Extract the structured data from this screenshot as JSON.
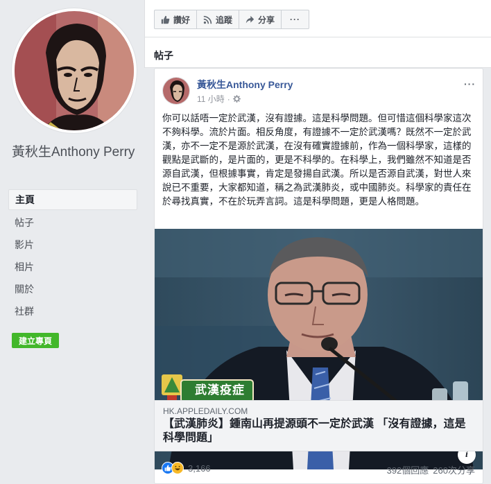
{
  "page": {
    "name": "黃秋生Anthony Perry"
  },
  "nav": {
    "items": [
      {
        "label": "主頁",
        "active": true
      },
      {
        "label": "帖子",
        "active": false
      },
      {
        "label": "影片",
        "active": false
      },
      {
        "label": "相片",
        "active": false
      },
      {
        "label": "關於",
        "active": false
      },
      {
        "label": "社群",
        "active": false
      }
    ],
    "create_page": "建立專頁"
  },
  "actions": {
    "like": "讚好",
    "follow": "追蹤",
    "share": "分享",
    "more": "···"
  },
  "section": {
    "title": "帖子"
  },
  "post": {
    "author": "黃秋生Anthony Perry",
    "time": "11 小時",
    "separator": "·",
    "more": "···",
    "text": "你可以話唔一定於武漢，沒有證據。這是科學問題。但可惜這個科學家這次不夠科學。流於片面。相反角度，有證據不一定於武漢嗎？既然不一定於武漢，亦不一定不是源於武漢，在沒有確實證據前，作為一個科學家，這樣的觀點是武斷的，是片面的，更是不科學的。在科學上，我們雖然不知道是否源自武漢，但根據事實，肯定是發揚自武漢。所以是否源自武漢，對世人來說已不重要，大家都知道，稱之為武漢肺炎，或中國肺炎。科學家的責任在於尋找真實，不在於玩弄言詞。這是科學問題，更是人格問題。",
    "photo_caption": "武漢疫症",
    "info": "i",
    "link": {
      "domain": "HK.APPLEDAILY.COM",
      "title": "【武漢肺炎】鍾南山再提源頭不一定於武漢 「沒有證據，這是科學問題」"
    },
    "reactions_count": "3,166",
    "comments": "392個回應",
    "shares": "260次分享"
  },
  "colors": {
    "facebook_blue": "#385898",
    "like_blue": "#1877f2",
    "haha_yellow": "#f7b928",
    "create_green": "#42b72a"
  },
  "icons": [
    "thumbs-up-icon",
    "rss-icon",
    "share-arrow-icon",
    "globe-icon",
    "info-icon",
    "like-reaction-icon",
    "haha-reaction-icon"
  ]
}
